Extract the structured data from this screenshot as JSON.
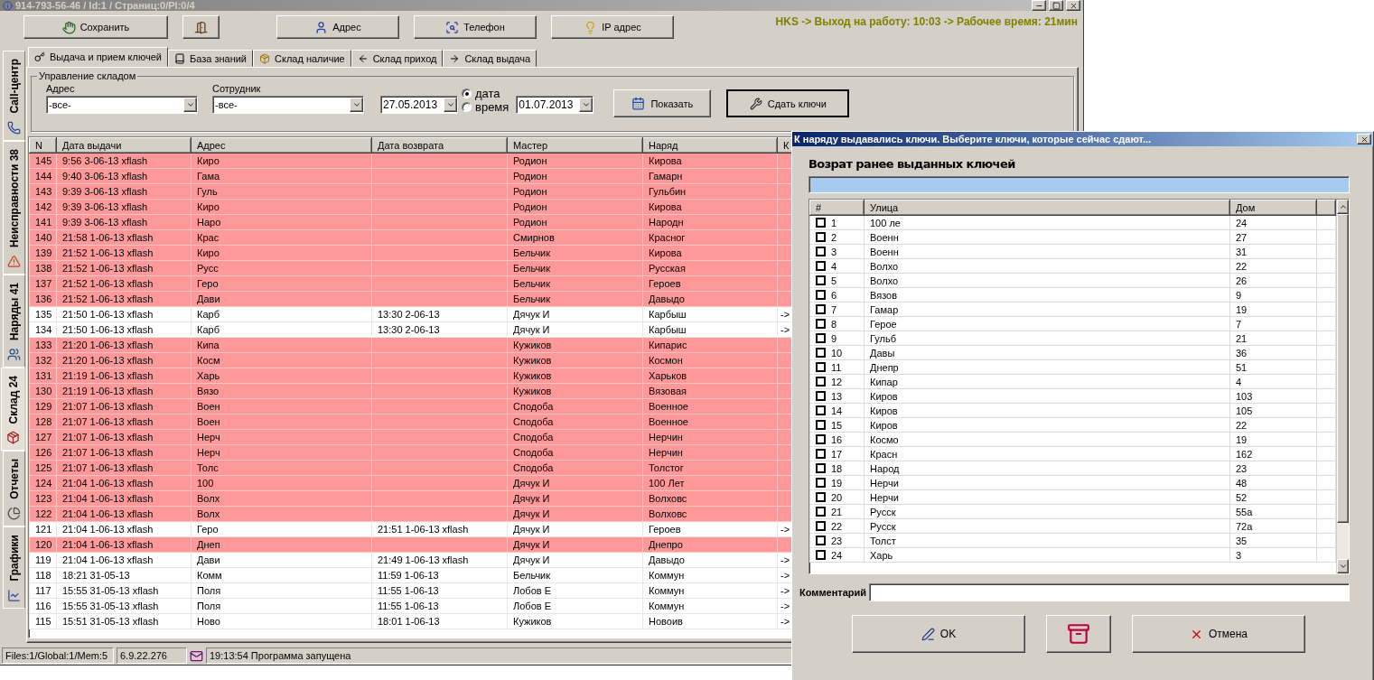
{
  "window": {
    "title": "914-793-56-46 / Id:1 / Страниц:0/Pl:0/4"
  },
  "status_banner": "HKS -> Выход на работу: 10:03 -> Рабочее время: 21мин",
  "toolbar": [
    {
      "kind": "text",
      "label": "Сохранить"
    },
    {
      "kind": "icon"
    },
    {
      "kind": "text",
      "label": "Адрес"
    },
    {
      "kind": "text",
      "label": "Телефон"
    },
    {
      "kind": "text",
      "label": "IP адрес"
    }
  ],
  "side_tabs": [
    {
      "label": "Call-центр",
      "selected": false
    },
    {
      "label": "Неисправности 38",
      "selected": false
    },
    {
      "label": "Наряды 41",
      "selected": false
    },
    {
      "label": "Склад 24",
      "selected": true
    },
    {
      "label": "Отчеты",
      "selected": false
    },
    {
      "label": "Графики",
      "selected": false
    }
  ],
  "tabs": [
    {
      "label": "Выдача и прием ключей",
      "selected": true
    },
    {
      "label": "База знаний",
      "selected": false
    },
    {
      "label": "Склад наличие",
      "selected": false
    },
    {
      "label": "Склад приход",
      "selected": false
    },
    {
      "label": "Склад выдача",
      "selected": false
    }
  ],
  "filter": {
    "title": "Управление складом",
    "address": {
      "label": "Адрес",
      "value": "-все-"
    },
    "employee": {
      "label": "Сотрудник",
      "value": "-все-"
    },
    "date_from": "27.05.2013",
    "mode": [
      {
        "label": "дата",
        "selected": true
      },
      {
        "label": "время",
        "selected": false
      }
    ],
    "date_to": "01.07.2013",
    "buttons": [
      "Показать",
      "Сдать ключи"
    ]
  },
  "table": {
    "columns": [
      "N",
      "Дата выдачи",
      "Адрес",
      "Дата возврата",
      "Мастер",
      "Наряд",
      "К"
    ],
    "rows": [
      {
        "n": "145",
        "issued": "9:56 3-06-13 xflash",
        "address": "Киро",
        "master": "Родион",
        "order": "Кирова",
        "returned": false
      },
      {
        "n": "144",
        "issued": "9:40 3-06-13 xflash",
        "address": "Гама",
        "master": "Родион",
        "order": "Гамарн",
        "returned": false
      },
      {
        "n": "143",
        "issued": "9:39 3-06-13 xflash",
        "address": "Гуль",
        "master": "Родион",
        "order": "Гульбин",
        "returned": false
      },
      {
        "n": "142",
        "issued": "9:39 3-06-13 xflash",
        "address": "Киро",
        "master": "Родион",
        "order": "Кирова",
        "returned": false
      },
      {
        "n": "141",
        "issued": "9:39 3-06-13 xflash",
        "address": "Наро",
        "master": "Родион",
        "order": "Народн",
        "returned": false
      },
      {
        "n": "140",
        "issued": "21:58 1-06-13 xflash",
        "address": "Крас",
        "master": "Смирнов",
        "order": "Красног",
        "returned": false
      },
      {
        "n": "139",
        "issued": "21:52 1-06-13 xflash",
        "address": "Киро",
        "master": "Бельчик",
        "order": "Кирова",
        "returned": false
      },
      {
        "n": "138",
        "issued": "21:52 1-06-13 xflash",
        "address": "Русс",
        "master": "Бельчик",
        "order": "Русская",
        "returned": false
      },
      {
        "n": "137",
        "issued": "21:52 1-06-13 xflash",
        "address": "Геро",
        "master": "Бельчик",
        "order": "Героев",
        "returned": false
      },
      {
        "n": "136",
        "issued": "21:52 1-06-13 xflash",
        "address": "Дави",
        "master": "Бельчик",
        "order": "Давыдо",
        "returned": false
      },
      {
        "n": "135",
        "issued": "21:50 1-06-13 xflash",
        "address": "Карб",
        "returned_at": "13:30 2-06-13",
        "master": "Дячук И",
        "order": "Карбыш",
        "column_7": "->",
        "returned": true
      },
      {
        "n": "134",
        "issued": "21:50 1-06-13 xflash",
        "address": "Карб",
        "returned_at": "13:30 2-06-13",
        "master": "Дячук И",
        "order": "Карбыш",
        "column_7": "->",
        "returned": true
      },
      {
        "n": "133",
        "issued": "21:20 1-06-13 xflash",
        "address": "Кипа",
        "master": "Кужиков",
        "order": "Кипарис",
        "returned": false
      },
      {
        "n": "132",
        "issued": "21:20 1-06-13 xflash",
        "address": "Косм",
        "master": "Кужиков",
        "order": "Космон",
        "returned": false
      },
      {
        "n": "131",
        "issued": "21:19 1-06-13 xflash",
        "address": "Харь",
        "master": "Кужиков",
        "order": "Харьков",
        "returned": false
      },
      {
        "n": "130",
        "issued": "21:19 1-06-13 xflash",
        "address": "Вязо",
        "master": "Кужиков",
        "order": "Вязовая",
        "returned": false
      },
      {
        "n": "129",
        "issued": "21:07 1-06-13 xflash",
        "address": "Воен",
        "master": "Сподоба",
        "order": "Военное",
        "returned": false
      },
      {
        "n": "128",
        "issued": "21:07 1-06-13 xflash",
        "address": "Воен",
        "master": "Сподоба",
        "order": "Военное",
        "returned": false
      },
      {
        "n": "127",
        "issued": "21:07 1-06-13 xflash",
        "address": "Нерч",
        "master": "Сподоба",
        "order": "Нерчин",
        "returned": false
      },
      {
        "n": "126",
        "issued": "21:07 1-06-13 xflash",
        "address": "Нерч",
        "master": "Сподоба",
        "order": "Нерчин",
        "returned": false
      },
      {
        "n": "125",
        "issued": "21:07 1-06-13 xflash",
        "address": "Толс",
        "master": "Сподоба",
        "order": "Толстог",
        "returned": false
      },
      {
        "n": "124",
        "issued": "21:04 1-06-13 xflash",
        "address": "100",
        "master": "Дячук И",
        "order": "100 Лет",
        "returned": false
      },
      {
        "n": "123",
        "issued": "21:04 1-06-13 xflash",
        "address": "Волх",
        "master": "Дячук И",
        "order": "Волховс",
        "returned": false
      },
      {
        "n": "122",
        "issued": "21:04 1-06-13 xflash",
        "address": "Волх",
        "master": "Дячук И",
        "order": "Волховс",
        "returned": false
      },
      {
        "n": "121",
        "issued": "21:04 1-06-13 xflash",
        "address": "Геро",
        "returned_at": "21:51 1-06-13 xflash",
        "master": "Дячук И",
        "order": "Героев",
        "column_7": "->",
        "returned": true
      },
      {
        "n": "120",
        "issued": "21:04 1-06-13 xflash",
        "address": "Днеп",
        "master": "Дячук И",
        "order": "Днепро",
        "returned": false
      },
      {
        "n": "119",
        "issued": "21:04 1-06-13 xflash",
        "address": "Дави",
        "returned_at": "21:49 1-06-13 xflash",
        "master": "Дячук И",
        "order": "Давыдо",
        "column_7": "->",
        "returned": true
      },
      {
        "n": "118",
        "issued": "18:21 31-05-13",
        "address": "Комм",
        "returned_at": "11:59 1-06-13",
        "master": "Бельчик",
        "order": "Коммун",
        "column_7": "->",
        "returned": true
      },
      {
        "n": "117",
        "issued": "15:55 31-05-13 xflash",
        "address": "Поля",
        "returned_at": "11:55 1-06-13",
        "master": "Лобов Е",
        "order": "Коммун",
        "column_7": "->",
        "returned": true
      },
      {
        "n": "116",
        "issued": "15:55 31-05-13 xflash",
        "address": "Поля",
        "returned_at": "11:55 1-06-13",
        "master": "Лобов Е",
        "order": "Коммун",
        "column_7": "->",
        "returned": true
      },
      {
        "n": "115",
        "issued": "15:51 31-05-13 xflash",
        "address": "Ново",
        "returned_at": "18:01 1-06-13",
        "master": "Кужиков",
        "order": "Новоив",
        "column_7": "->",
        "returned": true
      }
    ]
  },
  "status_bar": [
    "Files:1/Global:1/Mem:5",
    "6.9.22.276",
    "19:13:54 Программа запущена"
  ],
  "dialog": {
    "title": "К наряду выдавались ключи. Выберите ключи, которые сейчас сдают...",
    "heading": "Возрат ранее выданных ключей",
    "columns": [
      "#",
      "Улица",
      "Дом"
    ],
    "rows": [
      {
        "n": "1",
        "street": "100 ле",
        "house": "24",
        "checked": false
      },
      {
        "n": "2",
        "street": "Военн",
        "house": "27",
        "checked": false
      },
      {
        "n": "3",
        "street": "Военн",
        "house": "31",
        "checked": false
      },
      {
        "n": "4",
        "street": "Волхо",
        "house": "22",
        "checked": false
      },
      {
        "n": "5",
        "street": "Волхо",
        "house": "26",
        "checked": false
      },
      {
        "n": "6",
        "street": "Вязов",
        "house": "9",
        "checked": false
      },
      {
        "n": "7",
        "street": "Гамар",
        "house": "19",
        "checked": false
      },
      {
        "n": "8",
        "street": "Герое",
        "house": "7",
        "checked": false
      },
      {
        "n": "9",
        "street": "Гульб",
        "house": "21",
        "checked": false
      },
      {
        "n": "10",
        "street": "Давы",
        "house": "36",
        "checked": false
      },
      {
        "n": "11",
        "street": "Днепр",
        "house": "51",
        "checked": false
      },
      {
        "n": "12",
        "street": "Кипар",
        "house": "4",
        "checked": false
      },
      {
        "n": "13",
        "street": "Киров",
        "house": "103",
        "checked": false
      },
      {
        "n": "14",
        "street": "Киров",
        "house": "105",
        "checked": false
      },
      {
        "n": "15",
        "street": "Киров",
        "house": "22",
        "checked": false
      },
      {
        "n": "16",
        "street": "Космо",
        "house": "19",
        "checked": false
      },
      {
        "n": "17",
        "street": "Красн",
        "house": "162",
        "checked": false
      },
      {
        "n": "18",
        "street": "Народ",
        "house": "23",
        "checked": false
      },
      {
        "n": "19",
        "street": "Нерчи",
        "house": "48",
        "checked": false
      },
      {
        "n": "20",
        "street": "Нерчи",
        "house": "52",
        "checked": false
      },
      {
        "n": "21",
        "street": "Русск",
        "house": "55а",
        "checked": false
      },
      {
        "n": "22",
        "street": "Русск",
        "house": "72а",
        "checked": false
      },
      {
        "n": "23",
        "street": "Толст",
        "house": "35",
        "checked": false
      },
      {
        "n": "24",
        "street": "Харь",
        "house": "3",
        "checked": false
      }
    ],
    "comment_label": "Комментарий",
    "buttons": [
      {
        "kind": "text",
        "label": "OK"
      },
      {
        "kind": "icon"
      },
      {
        "kind": "text",
        "label": "Отмена"
      }
    ]
  }
}
